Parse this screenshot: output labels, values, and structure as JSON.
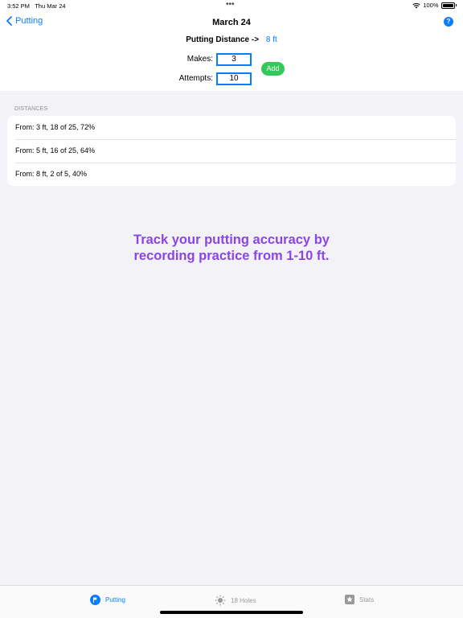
{
  "status_bar": {
    "time": "3:52 PM",
    "date": "Thu Mar 24",
    "dots": "•••",
    "battery": "100%"
  },
  "nav": {
    "back_label": "Putting",
    "title": "March 24",
    "help_label": "?"
  },
  "form": {
    "distance_label": "Putting Distance ->",
    "distance_value": "8 ft",
    "makes_label": "Makes:",
    "makes_value": "3",
    "attempts_label": "Attempts:",
    "attempts_value": "10",
    "add_label": "Add"
  },
  "distances": {
    "header": "DISTANCES",
    "items": [
      "From: 3 ft,   18 of 25,   72%",
      "From: 5 ft,   16 of 25,   64%",
      "From: 8 ft,   2 of 5,   40%"
    ]
  },
  "promo": {
    "line1": "Track your putting accuracy by",
    "line2": "recording practice from 1-10 ft."
  },
  "tabs": [
    {
      "label": "Putting",
      "icon": "flag-icon",
      "active": true
    },
    {
      "label": "18 Holes",
      "icon": "sun-icon",
      "active": false
    },
    {
      "label": "Stats",
      "icon": "star-icon",
      "active": false
    }
  ],
  "colors": {
    "accent": "#0a7cff",
    "add_button": "#34c759",
    "promo_text": "#8a45e6",
    "background": "#f2f2f7"
  }
}
